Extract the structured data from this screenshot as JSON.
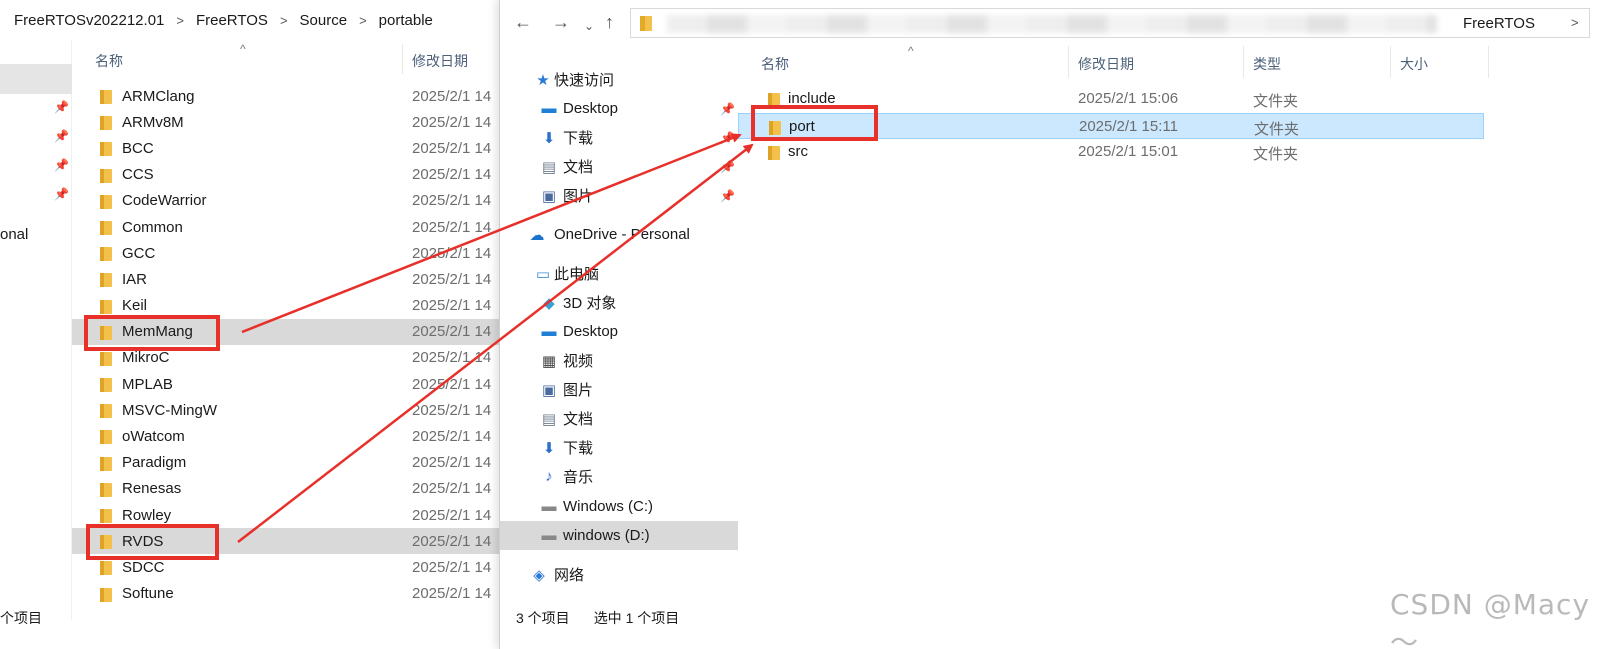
{
  "left_window": {
    "breadcrumb": [
      "FreeRTOSv202212.01",
      "FreeRTOS",
      "Source",
      "portable"
    ],
    "nav_partial_label": "onal",
    "columns": {
      "name": "名称",
      "date": "修改日期"
    },
    "files": [
      {
        "name": "ARMClang",
        "date": "2025/2/1 14"
      },
      {
        "name": "ARMv8M",
        "date": "2025/2/1 14"
      },
      {
        "name": "BCC",
        "date": "2025/2/1 14"
      },
      {
        "name": "CCS",
        "date": "2025/2/1 14"
      },
      {
        "name": "CodeWarrior",
        "date": "2025/2/1 14"
      },
      {
        "name": "Common",
        "date": "2025/2/1 14"
      },
      {
        "name": "GCC",
        "date": "2025/2/1 14"
      },
      {
        "name": "IAR",
        "date": "2025/2/1 14"
      },
      {
        "name": "Keil",
        "date": "2025/2/1 14"
      },
      {
        "name": "MemMang",
        "date": "2025/2/1 14"
      },
      {
        "name": "MikroC",
        "date": "2025/2/1 14"
      },
      {
        "name": "MPLAB",
        "date": "2025/2/1 14"
      },
      {
        "name": "MSVC-MingW",
        "date": "2025/2/1 14"
      },
      {
        "name": "oWatcom",
        "date": "2025/2/1 14"
      },
      {
        "name": "Paradigm",
        "date": "2025/2/1 14"
      },
      {
        "name": "Renesas",
        "date": "2025/2/1 14"
      },
      {
        "name": "Rowley",
        "date": "2025/2/1 14"
      },
      {
        "name": "RVDS",
        "date": "2025/2/1 14"
      },
      {
        "name": "SDCC",
        "date": "2025/2/1 14"
      },
      {
        "name": "Softune",
        "date": "2025/2/1 14"
      }
    ],
    "status": "个项目"
  },
  "right_window": {
    "address_tail": "FreeRTOS",
    "nav": [
      {
        "label": "快速访问",
        "icon": "star-icon"
      },
      {
        "label": "Desktop",
        "icon": "desktop-icon"
      },
      {
        "label": "下载",
        "icon": "download-icon"
      },
      {
        "label": "文档",
        "icon": "document-icon"
      },
      {
        "label": "图片",
        "icon": "picture-icon"
      },
      {
        "label": "OneDrive - Personal",
        "icon": "cloud-icon"
      },
      {
        "label": "此电脑",
        "icon": "computer-icon"
      },
      {
        "label": "3D 对象",
        "icon": "cube-icon"
      },
      {
        "label": "Desktop",
        "icon": "desktop-icon"
      },
      {
        "label": "视频",
        "icon": "video-icon"
      },
      {
        "label": "图片",
        "icon": "picture-icon"
      },
      {
        "label": "文档",
        "icon": "document-icon"
      },
      {
        "label": "下载",
        "icon": "download-icon"
      },
      {
        "label": "音乐",
        "icon": "music-icon"
      },
      {
        "label": "Windows (C:)",
        "icon": "drive-icon"
      },
      {
        "label": "windows (D:)",
        "icon": "drive-icon"
      },
      {
        "label": "网络",
        "icon": "network-icon"
      }
    ],
    "columns": {
      "name": "名称",
      "date": "修改日期",
      "type": "类型",
      "size": "大小"
    },
    "files": [
      {
        "name": "include",
        "date": "2025/2/1 15:06",
        "type": "文件夹"
      },
      {
        "name": "port",
        "date": "2025/2/1 15:11",
        "type": "文件夹"
      },
      {
        "name": "src",
        "date": "2025/2/1 15:01",
        "type": "文件夹"
      }
    ],
    "status": {
      "count": "3 个项目",
      "selected": "选中 1 个项目"
    }
  },
  "watermark": "CSDN @Macy～",
  "colors": {
    "annotation": "#e8302a",
    "selection": "#cce8ff",
    "folder": "#f3c14b"
  }
}
